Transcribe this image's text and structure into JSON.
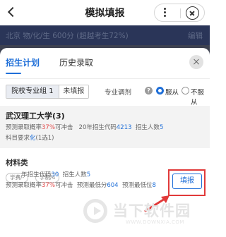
{
  "nav": {
    "title": "模拟填报"
  },
  "infobar": {
    "text": "北京 物/化/生 600分 (超越考生72%)",
    "edit": "编辑"
  },
  "tabs": [
    {
      "label": "招生计划"
    },
    {
      "label": "历史录取"
    }
  ],
  "filters": {
    "group": "院校专业组 1",
    "unfilled": "未填报",
    "adjust_label": "专业调剂",
    "help": "?",
    "options": [
      {
        "label": "服从",
        "selected": true
      },
      {
        "label": "不服从",
        "selected": false
      }
    ]
  },
  "school": {
    "name": "武汉理工大学(3)",
    "prob_prefix": "预测录取概率",
    "prob": "37%",
    "prob_suffix": "可冲击",
    "year_code_prefix": "20年招生代码",
    "code": "4213",
    "enroll_prefix": "招生人数",
    "enroll": "5",
    "subject_prefix": "科目要求",
    "subject": "化",
    "subject_suffix": "(1选1)"
  },
  "major": {
    "name": "材料类",
    "tags": [
      "学费/-",
      "学制/4"
    ],
    "code_prefix": "年招生代码",
    "code": "30",
    "enroll_prefix": "招生人数",
    "enroll": "5",
    "prob_prefix": "预测录取概率",
    "prob": "37%",
    "prob_suffix": "可冲击",
    "min_prefix": "预测最低分",
    "min": "604",
    "rank_prefix": "预测最低位",
    "rank": "8"
  },
  "fill_button": "填报",
  "watermark": {
    "text": "当下软件园",
    "sub": "WWW.DOWNXIA.COM"
  },
  "colors": {
    "accent": "#1f6fd8",
    "danger": "#e24d4d",
    "highlight": "#e13a3a",
    "header": "#2a3558"
  },
  "icons": {
    "back": "back-chevron-icon",
    "more": "more-dots-icon",
    "close": "close-circle-icon",
    "help": "question-icon"
  }
}
